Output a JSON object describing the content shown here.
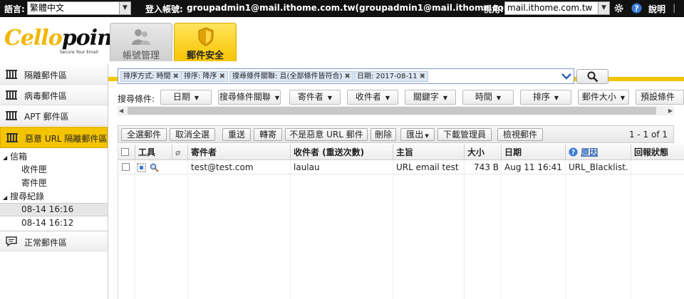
{
  "topbar": {
    "language_label": "語言:",
    "language_value": "繁體中文",
    "login_label": "登入帳號:",
    "login_value": "groupadmin1@mail.ithome.com.tw(groupadmin1@mail.ithome.com.tw)",
    "view_label": "視角:",
    "view_value": "mail.ithome.com.tw",
    "help_label": "說明"
  },
  "logo": {
    "part1": "Cello",
    "part2": "point",
    "tagline": "Secure Your Email"
  },
  "tabs": [
    {
      "label": "帳號管理"
    },
    {
      "label": "郵件安全"
    }
  ],
  "sidebar": {
    "items": [
      {
        "label": "隔離郵件區"
      },
      {
        "label": "病毒郵件區"
      },
      {
        "label": "APT 郵件區"
      },
      {
        "label": "惡意 URL 隔離郵件區"
      }
    ],
    "tree": {
      "mailbox": "信箱",
      "inbox": "收件匣",
      "sent": "寄件匣",
      "search_records": "搜尋紀錄",
      "records": [
        "08-14 16:16",
        "08-14 16:12"
      ]
    },
    "normal_mail": "正常郵件區"
  },
  "filters": {
    "chips": [
      "排序方式: 時間",
      "排序: 降序",
      "搜尋條件關聯: 且(全部條件皆符合)",
      "日期: 2017-08-11"
    ]
  },
  "conditions": {
    "label": "搜尋條件:",
    "dropdowns": [
      "日期",
      "搜尋條件關聯",
      "寄件者",
      "收件者",
      "關鍵字",
      "時間",
      "排序",
      "郵件大小",
      "預設條件"
    ]
  },
  "toolbar": {
    "buttons": [
      "全選郵件",
      "取消全選",
      "重送",
      "轉寄",
      "不是惡意 URL 郵件",
      "刪除",
      "匯出",
      "下載管理員",
      "檢視郵件"
    ],
    "pager": "1 - 1 of 1"
  },
  "table": {
    "headers": [
      "工具",
      "寄件者",
      "收件者 (重送次數)",
      "主旨",
      "大小",
      "日期",
      "原因",
      "回報狀態"
    ],
    "rows": [
      {
        "sender": "test@test.com",
        "recipient": "laulau",
        "subject": "URL email test",
        "size": "743 B",
        "date": "Aug 11 16:41",
        "reason": "URL_Blacklist..."
      }
    ]
  },
  "colors": {
    "accent": "#f5c400",
    "topbar": "#111111",
    "chip_bg": "#dde7f5"
  }
}
